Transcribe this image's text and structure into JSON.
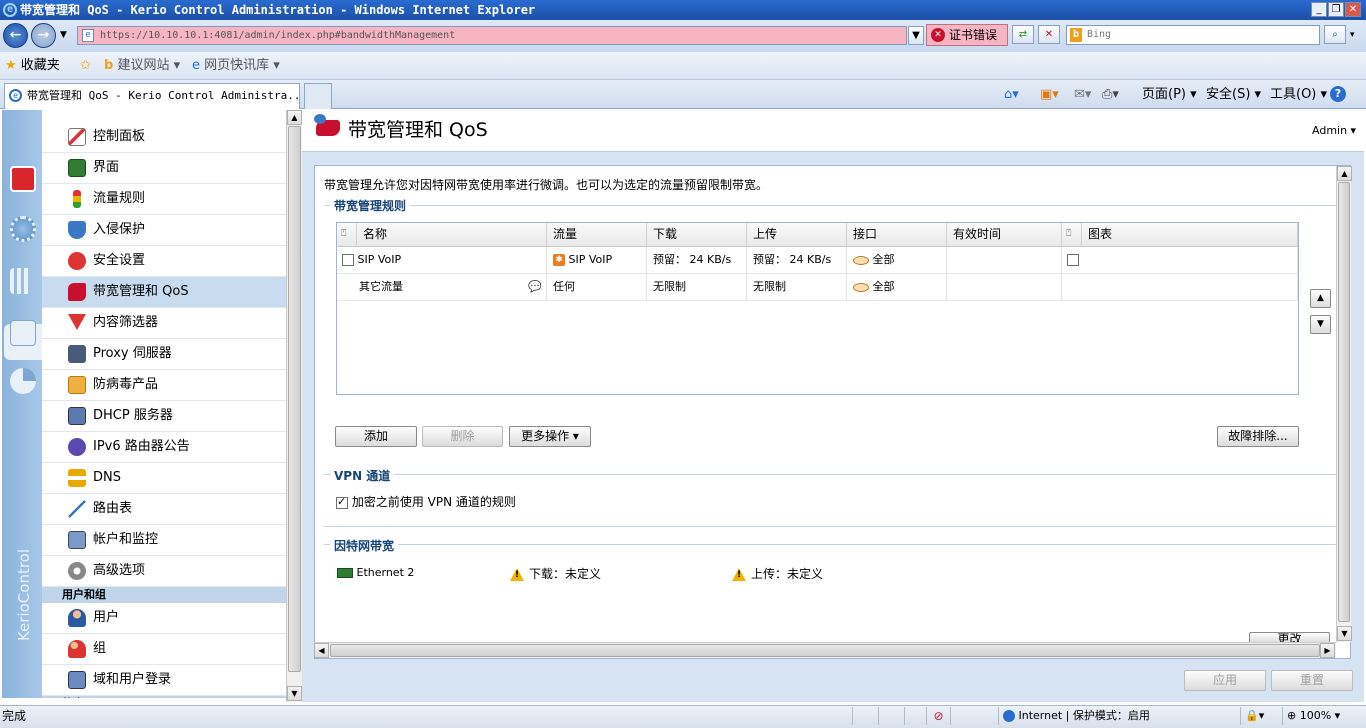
{
  "window": {
    "title": "带宽管理和 QoS - Kerio Control Administration - Windows Internet Explorer",
    "min": "_",
    "max": "❐",
    "close": "✕"
  },
  "browser": {
    "url": "https://10.10.10.1:4081/admin/index.php#bandwidthManagement",
    "cert_error": "证书错误",
    "search_placeholder": "Bing",
    "favorites": "收藏夹",
    "suggested_sites": "建议网站 ▾",
    "web_slices": "网页快讯库 ▾",
    "tab_title": "带宽管理和 QoS - Kerio Control Administra...",
    "page_menu": "页面(P) ▾",
    "safety_menu": "安全(S) ▾",
    "tools_menu": "工具(O) ▾",
    "help": "?"
  },
  "brand": "KerioControl",
  "nav": {
    "items": [
      {
        "label": "控制面板"
      },
      {
        "label": "界面"
      },
      {
        "label": "流量规则"
      },
      {
        "label": "入侵保护"
      },
      {
        "label": "安全设置"
      },
      {
        "label": "带宽管理和 QoS"
      },
      {
        "label": "内容筛选器"
      },
      {
        "label": "Proxy 伺服器"
      },
      {
        "label": "防病毒产品"
      },
      {
        "label": "DHCP 服务器"
      },
      {
        "label": "IPv6 路由器公告"
      },
      {
        "label": "DNS"
      },
      {
        "label": "路由表"
      },
      {
        "label": "帐户和监控"
      },
      {
        "label": "高级选项"
      }
    ],
    "group_header": "用户和组",
    "group_items": [
      {
        "label": "用户"
      },
      {
        "label": "组"
      },
      {
        "label": "域和用户登录"
      }
    ],
    "next_header": "状态"
  },
  "page": {
    "title": "带宽管理和 QoS",
    "user": "Admin ▾",
    "description": "带宽管理允许您对因特网带宽使用率进行微调。也可以为选定的流量预留限制带宽。",
    "rules_legend": "带宽管理规则",
    "columns": [
      "名称",
      "流量",
      "下载",
      "上传",
      "接口",
      "有效时间",
      "图表"
    ],
    "rows": [
      {
        "name": "SIP VoIP",
        "traffic": "SIP VoIP",
        "download": "预留： 24 KB/s",
        "upload": "预留： 24 KB/s",
        "interface": "全部",
        "valid_time": "",
        "chart": ""
      },
      {
        "name": "其它流量",
        "traffic": "任何",
        "download": "无限制",
        "upload": "无限制",
        "interface": "全部",
        "valid_time": "",
        "chart": ""
      }
    ],
    "buttons": {
      "add": "添加",
      "remove": "删除",
      "more": "更多操作 ▾",
      "troubleshoot": "故障排除..."
    },
    "vpn_legend": "VPN 通道",
    "vpn_checkbox": "加密之前使用 VPN 通道的规则",
    "internet_legend": "因特网带宽",
    "interface_name": "Ethernet 2",
    "download_label": "下载：未定义",
    "upload_label": "上传：未定义",
    "change": "更改",
    "apply": "应用",
    "reset": "重置"
  },
  "status": {
    "left": "完成",
    "zone": "Internet | 保护模式：启用",
    "zoom": "100%"
  },
  "colors": {
    "accent": "#17447a",
    "selected": "#c9dbef",
    "kerio_red": "#d8262c"
  }
}
